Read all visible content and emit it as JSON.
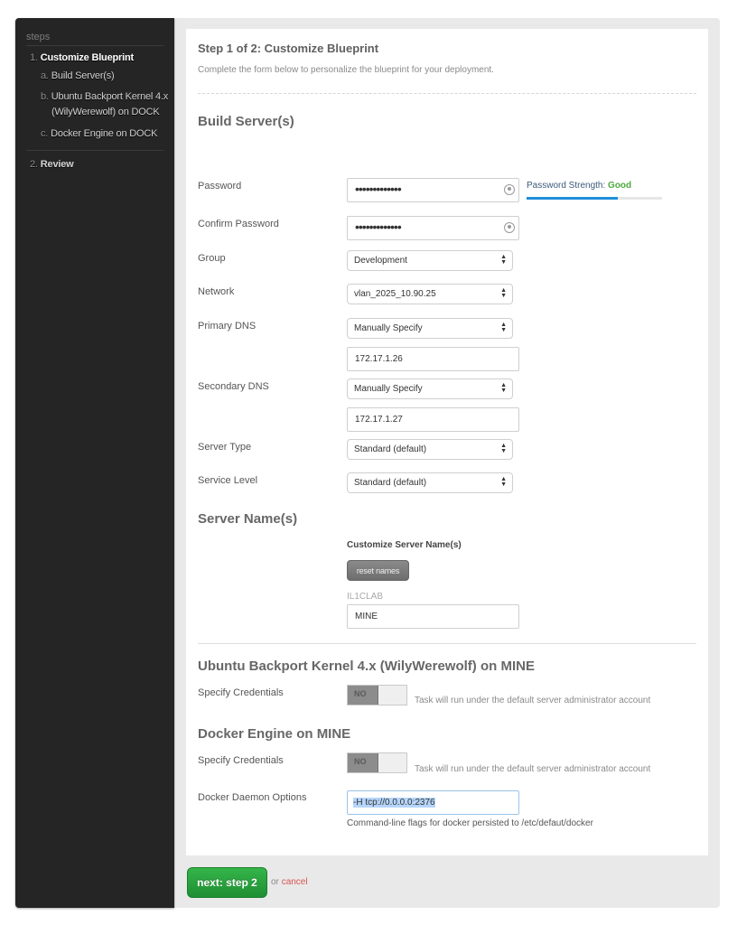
{
  "sidebar": {
    "heading": "steps",
    "items": [
      {
        "num": "1.",
        "label": "Customize Blueprint"
      },
      {
        "num": "a.",
        "label": "Build Server(s)"
      },
      {
        "num": "b.",
        "label": "Ubuntu Backport Kernel 4.x",
        "label2": "(WilyWerewolf) on DOCK"
      },
      {
        "num": "c.",
        "label": "Docker Engine on DOCK"
      },
      {
        "num": "2.",
        "label": "Review"
      }
    ]
  },
  "header": {
    "title": "Step 1 of 2: Customize Blueprint",
    "subtitle": "Complete the form below to personalize the blueprint for your deployment."
  },
  "build": {
    "heading": "Build Server(s)",
    "password": {
      "label": "Password",
      "value": "•••••••••••••"
    },
    "confirm_password": {
      "label": "Confirm Password",
      "value": "•••••••••••••"
    },
    "strength": {
      "label": "Password Strength:",
      "value": "Good",
      "percent": 67
    },
    "group": {
      "label": "Group",
      "value": "Development"
    },
    "network": {
      "label": "Network",
      "value": "vlan_2025_10.90.25"
    },
    "primary_dns": {
      "label": "Primary DNS",
      "mode": "Manually Specify",
      "value": "172.17.1.26"
    },
    "secondary_dns": {
      "label": "Secondary DNS",
      "mode": "Manually Specify",
      "value": "172.17.1.27"
    },
    "server_type": {
      "label": "Server Type",
      "value": "Standard (default)"
    },
    "service_level": {
      "label": "Service Level",
      "value": "Standard (default)"
    }
  },
  "server_names": {
    "heading": "Server Name(s)",
    "customize_label": "Customize Server Name(s)",
    "reset_label": "reset names",
    "prefix": "IL1CLAB",
    "value": "MINE"
  },
  "ubuntu": {
    "heading": "Ubuntu Backport Kernel 4.x (WilyWerewolf) on MINE",
    "cred_label": "Specify Credentials",
    "toggle": "NO",
    "note": "Task will run under the default server administrator account"
  },
  "docker": {
    "heading": "Docker Engine on MINE",
    "cred_label": "Specify Credentials",
    "toggle": "NO",
    "note": "Task will run under the default server administrator account",
    "daemon_label": "Docker Daemon Options",
    "daemon_value": "-H tcp://0.0.0.0:2376",
    "daemon_help": "Command-line flags for docker persisted to /etc/defaut/docker"
  },
  "footer": {
    "next_label": "next: step 2",
    "or": "or",
    "cancel": "cancel"
  },
  "colors": {
    "sidebar_bg": "#252525",
    "accent_green": "#2aa13e",
    "strength_blue": "#1f8fd9",
    "good_green": "#4aaa3c",
    "cancel_red": "#d9534f"
  }
}
